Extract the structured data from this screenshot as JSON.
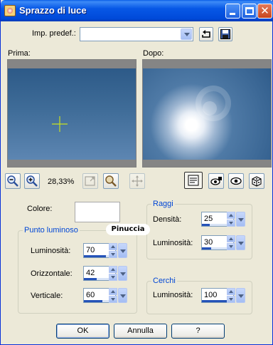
{
  "window": {
    "title": "Sprazzo di luce",
    "close_glyph": "✕"
  },
  "preset": {
    "label": "Imp. predef.:",
    "value": ""
  },
  "previews": {
    "before_label": "Prima:",
    "after_label": "Dopo:"
  },
  "zoom": {
    "level": "28,33%"
  },
  "colore": {
    "label": "Colore:",
    "color": "#ffffff"
  },
  "punto_luminoso": {
    "legend": "Punto luminoso",
    "luminosita": {
      "label": "Luminosità:",
      "value": "70"
    },
    "orizzontale": {
      "label": "Orizzontale:",
      "value": "42"
    },
    "verticale": {
      "label": "Verticale:",
      "value": "60"
    }
  },
  "raggi": {
    "legend": "Raggi",
    "densita": {
      "label": "Densità:",
      "value": "25"
    },
    "luminosita": {
      "label": "Luminosità:",
      "value": "30"
    }
  },
  "cerchi": {
    "legend": "Cerchi",
    "luminosita": {
      "label": "Luminosità:",
      "value": "100"
    }
  },
  "watermark": "Pinuccia",
  "buttons": {
    "ok": "OK",
    "cancel": "Annulla",
    "help": "?"
  },
  "colors": {
    "accent": "#0046d5",
    "titlebar": "#0058e6",
    "dialog_bg": "#ece9d8"
  },
  "icons": [
    "app-icon",
    "minimize-icon",
    "maximize-icon",
    "close-icon",
    "dropdown-arrow-icon",
    "reset-icon",
    "save-icon",
    "zoom-out-icon",
    "zoom-in-icon",
    "fit-to-window-icon",
    "zoom-100-icon",
    "pan-icon",
    "proof-icon",
    "lock-icon",
    "eye-icon",
    "random-icon"
  ]
}
